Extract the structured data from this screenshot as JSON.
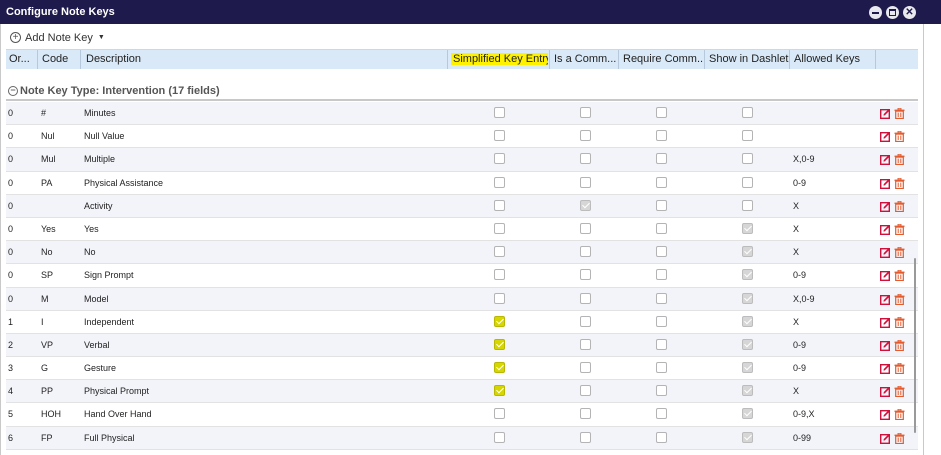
{
  "window": {
    "title": "Configure Note Keys"
  },
  "toolbar": {
    "add_label": "Add Note Key"
  },
  "columns": {
    "order": "Or...",
    "code": "Code",
    "description": "Description",
    "simplified": "Simplified Key Entry",
    "is_comment": "Is a Comm...",
    "require_comment": "Require Comm...",
    "show_dashlet": "Show in Dashlet",
    "allowed_keys": "Allowed Keys"
  },
  "group": {
    "label": "Note Key Type: Intervention (17 fields)"
  },
  "colors": {
    "titlebar": "#1e1a4b",
    "header_bg": "#d9e9f7",
    "highlight": "#fff200",
    "edit_icon": "#d0103a",
    "delete_icon": "#e35b2e"
  },
  "rows": [
    {
      "order": "0",
      "code": "#",
      "description": "Minutes",
      "simplified": false,
      "is_comment": false,
      "require_comment": false,
      "show_dashlet": false,
      "allowed": ""
    },
    {
      "order": "0",
      "code": "Nul",
      "description": "Null Value",
      "simplified": false,
      "is_comment": false,
      "require_comment": false,
      "show_dashlet": false,
      "allowed": ""
    },
    {
      "order": "0",
      "code": "Mul",
      "description": "Multiple",
      "simplified": false,
      "is_comment": false,
      "require_comment": false,
      "show_dashlet": false,
      "allowed": "X,0-9"
    },
    {
      "order": "0",
      "code": "PA",
      "description": "Physical Assistance",
      "simplified": false,
      "is_comment": false,
      "require_comment": false,
      "show_dashlet": false,
      "allowed": "0-9"
    },
    {
      "order": "0",
      "code": "",
      "description": "Activity",
      "simplified": false,
      "is_comment": true,
      "require_comment": false,
      "show_dashlet": false,
      "allowed": "X"
    },
    {
      "order": "0",
      "code": "Yes",
      "description": "Yes",
      "simplified": false,
      "is_comment": false,
      "require_comment": false,
      "show_dashlet": true,
      "allowed": "X"
    },
    {
      "order": "0",
      "code": "No",
      "description": "No",
      "simplified": false,
      "is_comment": false,
      "require_comment": false,
      "show_dashlet": true,
      "allowed": "X"
    },
    {
      "order": "0",
      "code": "SP",
      "description": "Sign Prompt",
      "simplified": false,
      "is_comment": false,
      "require_comment": false,
      "show_dashlet": true,
      "allowed": "0-9"
    },
    {
      "order": "0",
      "code": "M",
      "description": "Model",
      "simplified": false,
      "is_comment": false,
      "require_comment": false,
      "show_dashlet": true,
      "allowed": "X,0-9"
    },
    {
      "order": "1",
      "code": "I",
      "description": "Independent",
      "simplified": true,
      "is_comment": false,
      "require_comment": false,
      "show_dashlet": true,
      "allowed": "X"
    },
    {
      "order": "2",
      "code": "VP",
      "description": "Verbal",
      "simplified": true,
      "is_comment": false,
      "require_comment": false,
      "show_dashlet": true,
      "allowed": "0-9"
    },
    {
      "order": "3",
      "code": "G",
      "description": "Gesture",
      "simplified": true,
      "is_comment": false,
      "require_comment": false,
      "show_dashlet": true,
      "allowed": "0-9"
    },
    {
      "order": "4",
      "code": "PP",
      "description": "Physical Prompt",
      "simplified": true,
      "is_comment": false,
      "require_comment": false,
      "show_dashlet": true,
      "allowed": "X"
    },
    {
      "order": "5",
      "code": "HOH",
      "description": "Hand Over Hand",
      "simplified": false,
      "is_comment": false,
      "require_comment": false,
      "show_dashlet": true,
      "allowed": "0-9,X"
    },
    {
      "order": "6",
      "code": "FP",
      "description": "Full Physical",
      "simplified": false,
      "is_comment": false,
      "require_comment": false,
      "show_dashlet": true,
      "allowed": "0-99"
    }
  ]
}
